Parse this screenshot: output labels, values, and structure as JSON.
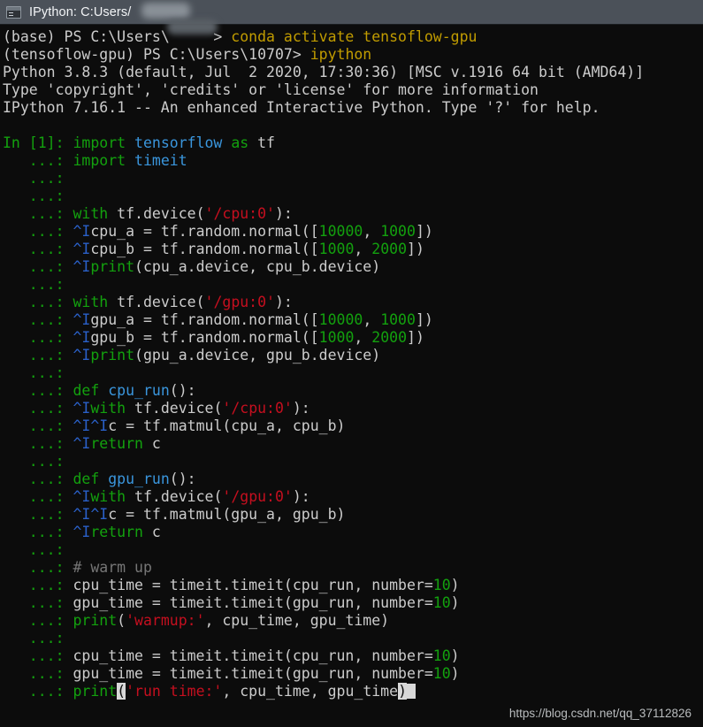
{
  "window": {
    "title": "IPython: C:Users/",
    "title_redacted_suffix": "█████",
    "icon": "terminal-icon"
  },
  "colors": {
    "background": "#0c0c0c",
    "titlebar": "#4b5159",
    "foreground": "#cccccc",
    "green": "#13a10e",
    "cyan": "#3a96dd",
    "red": "#c50f1f",
    "yellow": "#c19c00",
    "gray": "#767676",
    "indent_guide": "#2a60c8",
    "highlight": "#d8d8d8"
  },
  "shell": {
    "line1": {
      "env": "(base)",
      "ps": " PS C:\\Users\\",
      "user_redacted": "10707",
      "arrow": "> ",
      "command": "conda activate tensoflow-gpu"
    },
    "line2": {
      "env": "(tensoflow-gpu)",
      "ps": " PS C:\\Users\\10707> ",
      "command": "ipython"
    },
    "banner": [
      "Python 3.8.3 (default, Jul  2 2020, 17:30:36) [MSC v.1916 64 bit (AMD64)]",
      "Type 'copyright', 'credits' or 'license' for more information",
      "IPython 7.16.1 -- An enhanced Interactive Python. Type '?' for help."
    ]
  },
  "prompts": {
    "first": "In [1]: ",
    "cont": "   ...: "
  },
  "code_lines": [
    {
      "prompt": "first",
      "tokens": [
        {
          "t": "import ",
          "c": "g"
        },
        {
          "t": "tensorflow",
          "c": "c"
        },
        {
          "t": " ",
          "c": "w"
        },
        {
          "t": "as",
          "c": "g"
        },
        {
          "t": " tf",
          "c": "w"
        }
      ]
    },
    {
      "prompt": "cont",
      "tokens": [
        {
          "t": "import ",
          "c": "g"
        },
        {
          "t": "timeit",
          "c": "c"
        }
      ]
    },
    {
      "prompt": "cont",
      "tokens": []
    },
    {
      "prompt": "cont",
      "tokens": []
    },
    {
      "prompt": "cont",
      "tokens": [
        {
          "t": "with",
          "c": "g"
        },
        {
          "t": " tf.device(",
          "c": "w"
        },
        {
          "t": "'/cpu:0'",
          "c": "r"
        },
        {
          "t": "):",
          "c": "w"
        }
      ]
    },
    {
      "prompt": "cont",
      "tokens": [
        {
          "t": "^I",
          "c": "ind"
        },
        {
          "t": "cpu_a = tf.random.normal([",
          "c": "w"
        },
        {
          "t": "10000",
          "c": "g"
        },
        {
          "t": ", ",
          "c": "w"
        },
        {
          "t": "1000",
          "c": "g"
        },
        {
          "t": "])",
          "c": "w"
        }
      ]
    },
    {
      "prompt": "cont",
      "tokens": [
        {
          "t": "^I",
          "c": "ind"
        },
        {
          "t": "cpu_b = tf.random.normal([",
          "c": "w"
        },
        {
          "t": "1000",
          "c": "g"
        },
        {
          "t": ", ",
          "c": "w"
        },
        {
          "t": "2000",
          "c": "g"
        },
        {
          "t": "])",
          "c": "w"
        }
      ]
    },
    {
      "prompt": "cont",
      "tokens": [
        {
          "t": "^I",
          "c": "ind"
        },
        {
          "t": "print",
          "c": "g"
        },
        {
          "t": "(cpu_a.device, cpu_b.device)",
          "c": "w"
        }
      ]
    },
    {
      "prompt": "cont",
      "tokens": []
    },
    {
      "prompt": "cont",
      "tokens": [
        {
          "t": "with",
          "c": "g"
        },
        {
          "t": " tf.device(",
          "c": "w"
        },
        {
          "t": "'/gpu:0'",
          "c": "r"
        },
        {
          "t": "):",
          "c": "w"
        }
      ]
    },
    {
      "prompt": "cont",
      "tokens": [
        {
          "t": "^I",
          "c": "ind"
        },
        {
          "t": "gpu_a = tf.random.normal([",
          "c": "w"
        },
        {
          "t": "10000",
          "c": "g"
        },
        {
          "t": ", ",
          "c": "w"
        },
        {
          "t": "1000",
          "c": "g"
        },
        {
          "t": "])",
          "c": "w"
        }
      ]
    },
    {
      "prompt": "cont",
      "tokens": [
        {
          "t": "^I",
          "c": "ind"
        },
        {
          "t": "gpu_b = tf.random.normal([",
          "c": "w"
        },
        {
          "t": "1000",
          "c": "g"
        },
        {
          "t": ", ",
          "c": "w"
        },
        {
          "t": "2000",
          "c": "g"
        },
        {
          "t": "])",
          "c": "w"
        }
      ]
    },
    {
      "prompt": "cont",
      "tokens": [
        {
          "t": "^I",
          "c": "ind"
        },
        {
          "t": "print",
          "c": "g"
        },
        {
          "t": "(gpu_a.device, gpu_b.device)",
          "c": "w"
        }
      ]
    },
    {
      "prompt": "cont",
      "tokens": []
    },
    {
      "prompt": "cont",
      "tokens": [
        {
          "t": "def",
          "c": "g"
        },
        {
          "t": " ",
          "c": "w"
        },
        {
          "t": "cpu_run",
          "c": "c"
        },
        {
          "t": "():",
          "c": "w"
        }
      ]
    },
    {
      "prompt": "cont",
      "tokens": [
        {
          "t": "^I",
          "c": "ind"
        },
        {
          "t": "with",
          "c": "g"
        },
        {
          "t": " tf.device(",
          "c": "w"
        },
        {
          "t": "'/cpu:0'",
          "c": "r"
        },
        {
          "t": "):",
          "c": "w"
        }
      ]
    },
    {
      "prompt": "cont",
      "tokens": [
        {
          "t": "^I^I",
          "c": "ind"
        },
        {
          "t": "c = tf.matmul(cpu_a, cpu_b)",
          "c": "w"
        }
      ]
    },
    {
      "prompt": "cont",
      "tokens": [
        {
          "t": "^I",
          "c": "ind"
        },
        {
          "t": "return",
          "c": "g"
        },
        {
          "t": " c",
          "c": "w"
        }
      ]
    },
    {
      "prompt": "cont",
      "tokens": []
    },
    {
      "prompt": "cont",
      "tokens": [
        {
          "t": "def",
          "c": "g"
        },
        {
          "t": " ",
          "c": "w"
        },
        {
          "t": "gpu_run",
          "c": "c"
        },
        {
          "t": "():",
          "c": "w"
        }
      ]
    },
    {
      "prompt": "cont",
      "tokens": [
        {
          "t": "^I",
          "c": "ind"
        },
        {
          "t": "with",
          "c": "g"
        },
        {
          "t": " tf.device(",
          "c": "w"
        },
        {
          "t": "'/gpu:0'",
          "c": "r"
        },
        {
          "t": "):",
          "c": "w"
        }
      ]
    },
    {
      "prompt": "cont",
      "tokens": [
        {
          "t": "^I^I",
          "c": "ind"
        },
        {
          "t": "c = tf.matmul(gpu_a, gpu_b)",
          "c": "w"
        }
      ]
    },
    {
      "prompt": "cont",
      "tokens": [
        {
          "t": "^I",
          "c": "ind"
        },
        {
          "t": "return",
          "c": "g"
        },
        {
          "t": " c",
          "c": "w"
        }
      ]
    },
    {
      "prompt": "cont",
      "tokens": []
    },
    {
      "prompt": "cont",
      "tokens": [
        {
          "t": "# warm up",
          "c": "gy"
        }
      ]
    },
    {
      "prompt": "cont",
      "tokens": [
        {
          "t": "cpu_time = timeit.timeit(cpu_run, number=",
          "c": "w"
        },
        {
          "t": "10",
          "c": "g"
        },
        {
          "t": ")",
          "c": "w"
        }
      ]
    },
    {
      "prompt": "cont",
      "tokens": [
        {
          "t": "gpu_time = timeit.timeit(gpu_run, number=",
          "c": "w"
        },
        {
          "t": "10",
          "c": "g"
        },
        {
          "t": ")",
          "c": "w"
        }
      ]
    },
    {
      "prompt": "cont",
      "tokens": [
        {
          "t": "print",
          "c": "g"
        },
        {
          "t": "(",
          "c": "w"
        },
        {
          "t": "'warmup:'",
          "c": "r"
        },
        {
          "t": ", cpu_time, gpu_time)",
          "c": "w"
        }
      ]
    },
    {
      "prompt": "cont",
      "tokens": []
    },
    {
      "prompt": "cont",
      "tokens": [
        {
          "t": "cpu_time = timeit.timeit(cpu_run, number=",
          "c": "w"
        },
        {
          "t": "10",
          "c": "g"
        },
        {
          "t": ")",
          "c": "w"
        }
      ]
    },
    {
      "prompt": "cont",
      "tokens": [
        {
          "t": "gpu_time = timeit.timeit(gpu_run, number=",
          "c": "w"
        },
        {
          "t": "10",
          "c": "g"
        },
        {
          "t": ")",
          "c": "w"
        }
      ]
    },
    {
      "prompt": "cont",
      "tokens": [
        {
          "t": "print",
          "c": "g"
        },
        {
          "t": "(",
          "c": "hl"
        },
        {
          "t": "'run time:'",
          "c": "r"
        },
        {
          "t": ", cpu_time, gpu_time",
          "c": "w"
        },
        {
          "t": ")",
          "c": "hl"
        },
        {
          "t": "",
          "c": "cursor"
        }
      ]
    }
  ],
  "watermark": "https://blog.csdn.net/qq_37112826"
}
